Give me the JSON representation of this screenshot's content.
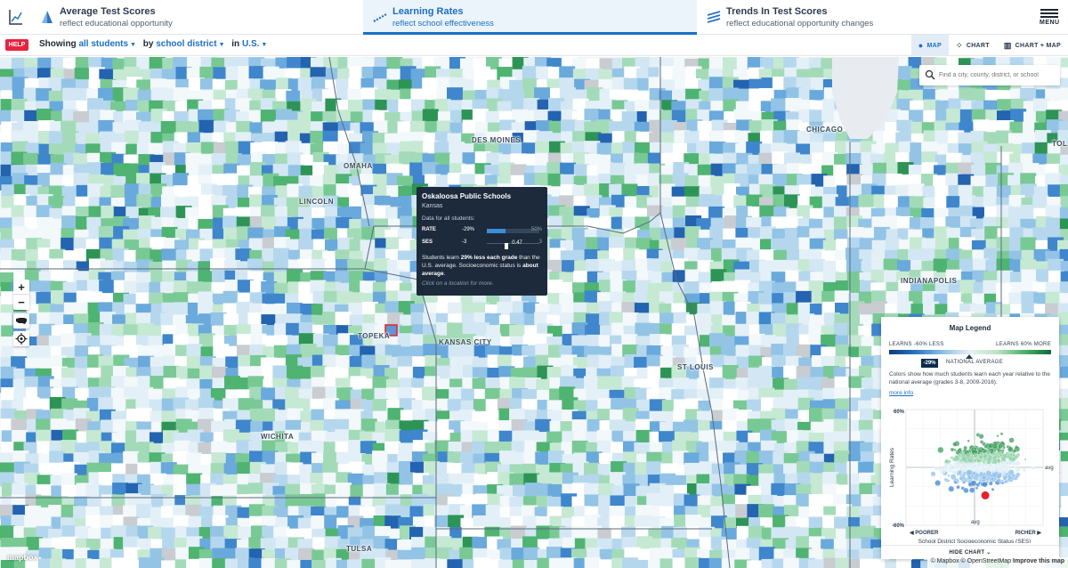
{
  "tabs": [
    {
      "title": "Average Test Scores",
      "subtitle": "reflect educational opportunity"
    },
    {
      "title": "Learning Rates",
      "subtitle": "reflect school effectiveness"
    },
    {
      "title": "Trends In Test Scores",
      "subtitle": "reflect educational opportunity changes"
    }
  ],
  "menu_label": "MENU",
  "help_label": "HELP",
  "selector": {
    "showing": "Showing",
    "students": "all students",
    "by": "by",
    "region": "school district",
    "in": "in",
    "area": "U.S."
  },
  "views": [
    "MAP",
    "CHART",
    "CHART + MAP"
  ],
  "search": {
    "placeholder": "Find a city, county, district, or school"
  },
  "cities": [
    "DES MOINES",
    "CHICAGO",
    "OMAHA",
    "LINCOLN",
    "TOPEKA",
    "KANSAS CITY",
    "INDIANAPOLIS",
    "ST LOUIS",
    "WICHITA",
    "TULSA",
    "TOL"
  ],
  "tooltip": {
    "title": "Oskaloosa Public Schools",
    "state": "Kansas",
    "subtitle": "Data for all students:",
    "rate": {
      "label": "RATE",
      "min": "-29%",
      "max": "50%",
      "value_fraction": 0.36
    },
    "ses": {
      "label": "SES",
      "min": "-3",
      "max": "3",
      "value": "0.47",
      "value_fraction": 0.58
    },
    "desc_pre": "Students learn ",
    "desc_bold": "29% less each grade",
    "desc_mid": " than the U.S. average. Socioeconomic status is ",
    "desc_bold2": "about average",
    "desc_end": ".",
    "click": "Click on a location for more."
  },
  "legend": {
    "title": "Map Legend",
    "left": "LEARNS -60% LESS",
    "right": "LEARNS 60% MORE",
    "badge": "-29%",
    "national": "NATIONAL AVERAGE",
    "text": "Colors show how much students learn each year relative to the national average (grades 3-8, 2009-2016).",
    "link": "more info",
    "hide": "HIDE CHART"
  },
  "chart_data": {
    "type": "scatter",
    "xlabel": "School District Socioeconomic Status (SES)",
    "ylabel": "Learning Rates",
    "y_tick_labels": [
      "60%",
      "-60%"
    ],
    "avg_label_x": "avg",
    "avg_label_y": "avg",
    "x_left": "POORER",
    "x_right": "RICHER",
    "ylim": [
      -0.6,
      0.6
    ],
    "xlim": [
      -3,
      3
    ],
    "highlight": {
      "name": "Oskaloosa Public Schools",
      "x": 0.47,
      "y": -0.29,
      "color": "#e6202a"
    }
  },
  "attribution": {
    "mapbox": "© Mapbox",
    "osm": "© OpenStreetMap",
    "improve": "Improve this map"
  },
  "mapbox_logo": "mapbox",
  "colors": {
    "accent": "#1a6fc4",
    "help": "#e6243f",
    "tooltip_bg": "#1d2a3b"
  }
}
